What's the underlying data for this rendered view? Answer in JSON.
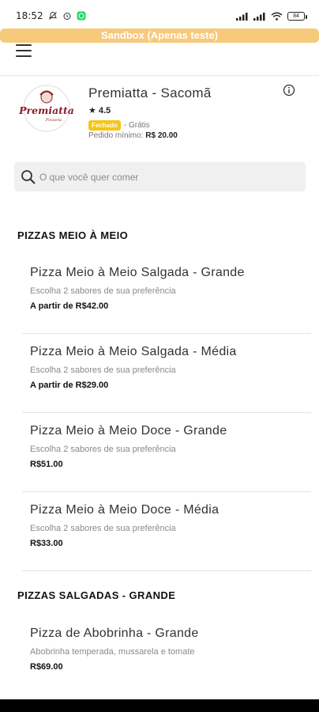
{
  "status_bar": {
    "time": "18:52",
    "battery": "84"
  },
  "sandbox_banner": "Sandbox (Apenas teste)",
  "store": {
    "logo_text": "Premiatta",
    "logo_subtext": "Pizzaria",
    "name": "Premiatta - Sacomã",
    "rating": "4.5",
    "status_badge": "Fechado",
    "delivery": "- Grátis",
    "min_order_label": "Pedido mínimo:",
    "min_order_value": "R$ 20.00"
  },
  "search": {
    "placeholder": "O que você quer comer"
  },
  "sections": [
    {
      "title": "PIZZAS MEIO À MEIO",
      "items": [
        {
          "name": "Pizza Meio à Meio Salgada - Grande",
          "description": "Escolha 2 sabores de sua preferência",
          "price": "A partir de R$42.00"
        },
        {
          "name": "Pizza Meio à Meio Salgada - Média",
          "description": "Escolha 2 sabores de sua preferência",
          "price": "A partir de R$29.00"
        },
        {
          "name": "Pizza Meio à Meio Doce - Grande",
          "description": "Escolha 2 sabores de sua preferência",
          "price": "R$51.00"
        },
        {
          "name": "Pizza Meio à Meio Doce - Média",
          "description": "Escolha 2 sabores de sua preferência",
          "price": "R$33.00"
        }
      ]
    },
    {
      "title": "PIZZAS SALGADAS - GRANDE",
      "items": [
        {
          "name": "Pizza de Abobrinha - Grande",
          "description": "Abobrinha temperada, mussarela e tomate",
          "price": "R$69.00"
        }
      ]
    }
  ],
  "colors": {
    "sandbox": "#f7c97a",
    "badge": "#f5c518",
    "brand": "#8b1d2c"
  },
  "icons": [
    "notification-off-icon",
    "alarm-icon",
    "whatsapp-icon",
    "signal-icon",
    "wifi-icon",
    "battery-icon",
    "menu-icon",
    "info-icon",
    "search-icon",
    "star-icon"
  ]
}
